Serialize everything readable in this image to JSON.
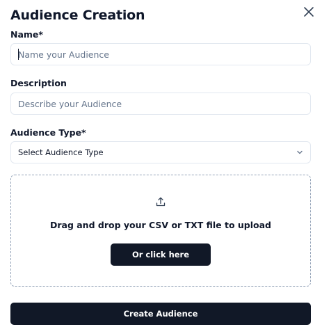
{
  "dialog": {
    "title": "Audience Creation",
    "close_icon": "close-icon"
  },
  "form": {
    "name": {
      "label": "Name*",
      "placeholder": "Name your Audience",
      "value": ""
    },
    "description": {
      "label": "Description",
      "placeholder": "Describe your Audience",
      "value": ""
    },
    "audience_type": {
      "label": "Audience Type*",
      "selected": "Select Audience Type",
      "icon": "chevron-down-icon"
    }
  },
  "upload": {
    "icon": "upload-icon",
    "instruction": "Drag and drop your CSV or TXT file to upload",
    "button_label": "Or click here"
  },
  "footer": {
    "create_label": "Create Audience"
  },
  "colors": {
    "primary_button": "#111827",
    "text": "#0f172a",
    "border": "#e2e8f0",
    "placeholder": "#64748b"
  }
}
